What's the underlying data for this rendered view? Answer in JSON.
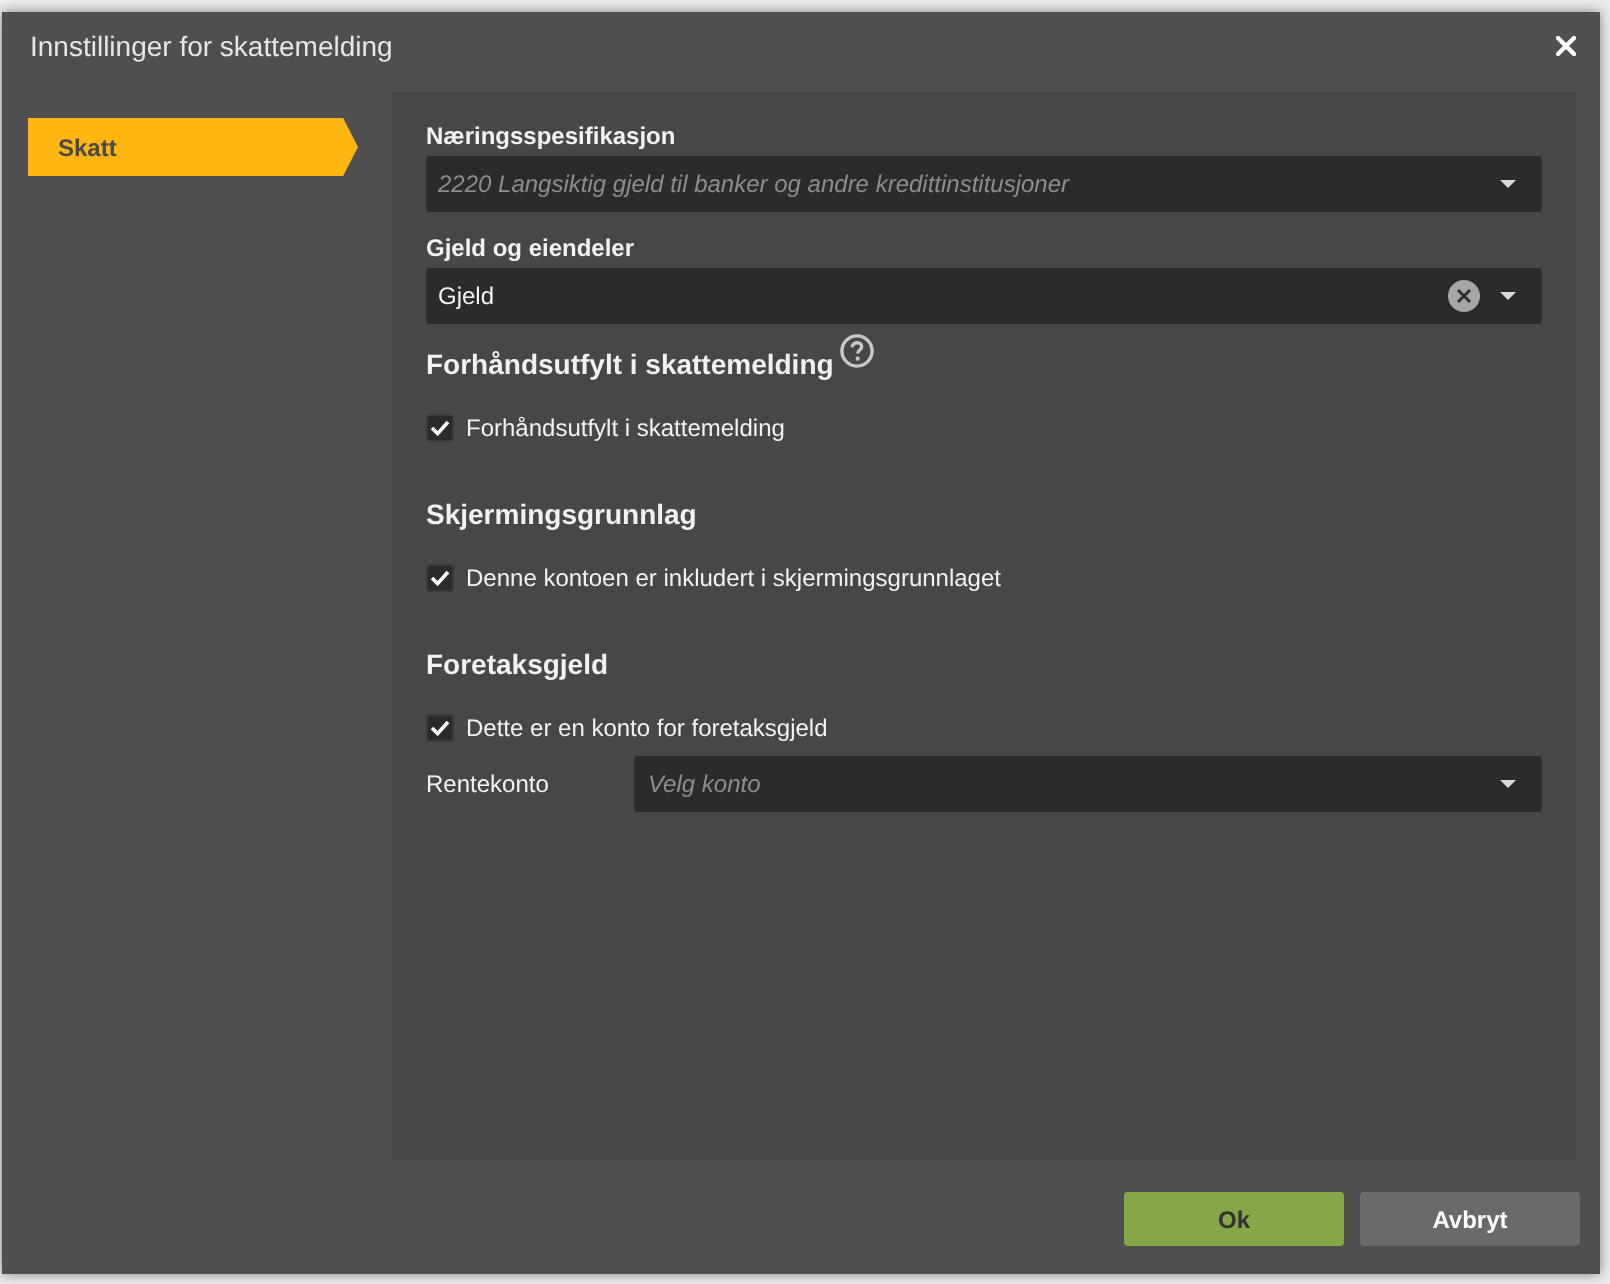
{
  "window": {
    "title": "Innstillinger for skattemelding"
  },
  "sidebar": {
    "items": [
      {
        "label": "Skatt",
        "selected": true
      }
    ]
  },
  "fields": [
    {
      "label": "Næringsspesifikasjon",
      "value": "2220 Langsiktig gjeld til banker og andre kredittinstitusjoner",
      "disabled": true
    },
    {
      "label": "Gjeld og eiendeler",
      "value": "Gjeld",
      "disabled": false
    }
  ],
  "sections": [
    {
      "heading": "Forhåndsutfylt i skattemelding",
      "help": true,
      "checkbox": {
        "label": "Forhåndsutfylt i skattemelding",
        "checked": true
      }
    },
    {
      "heading": "Skjermingsgrunnlag",
      "checkbox": {
        "label": "Denne kontoen er inkludert i skjermingsgrunnlaget",
        "checked": true
      }
    },
    {
      "heading": "Foretaksgjeld",
      "checkbox": {
        "label": "Dette er en konto for foretaksgjeld",
        "checked": true
      },
      "fields": [
        {
          "label": "Rentekonto",
          "placeholder": "Velg konto"
        }
      ]
    }
  ],
  "buttons": [
    {
      "label": "Ok",
      "kind": "primary"
    },
    {
      "label": "Avbryt",
      "kind": "secondary"
    }
  ]
}
